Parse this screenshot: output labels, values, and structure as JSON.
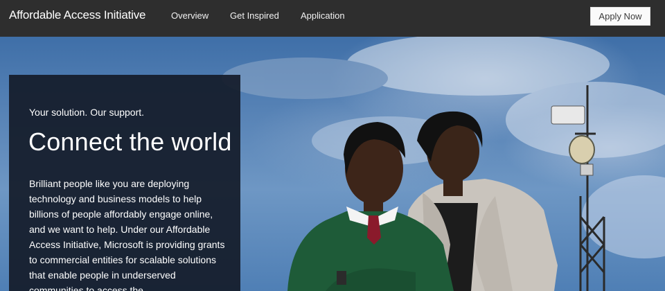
{
  "nav": {
    "brand": "Affordable Access Initiative",
    "links": [
      "Overview",
      "Get Inspired",
      "Application"
    ],
    "cta": "Apply Now"
  },
  "hero": {
    "tagline": "Your solution. Our support.",
    "headline": "Connect the world",
    "body": "Brilliant people like you are deploying technology and business models to help billions of people affordably engage online, and we want to help. Under our Affordable Access Initiative, Microsoft is providing grants to commercial entities for scalable solutions that enable people in underserved communities to access the",
    "photo_subject": "student and woman standing in front of a communications tower under a blue sky"
  },
  "colors": {
    "nav_bg": "#2e2e2e",
    "panel_bg": "#141c2a",
    "sky": "#5b86b8",
    "cta_bg": "#fafafa"
  }
}
